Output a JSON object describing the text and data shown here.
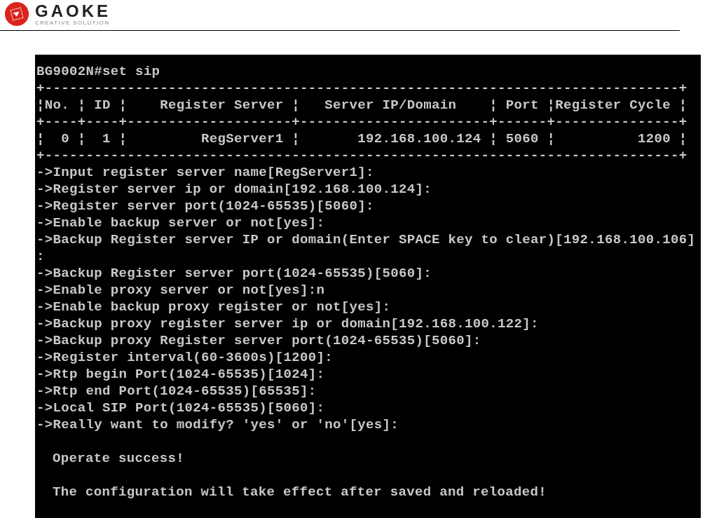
{
  "header": {
    "brand": "GAOKE",
    "tagline": "CREATIVE SOLUTION"
  },
  "terminal": {
    "lines": [
      "BG9002N#set sip",
      "+-----------------------------------------------------------------------------+",
      "¦No. ¦ ID ¦    Register Server ¦   Server IP/Domain    ¦ Port ¦Register Cycle ¦",
      "+----+----+--------------------+-----------------------+------+---------------+",
      "¦  0 ¦  1 ¦         RegServer1 ¦       192.168.100.124 ¦ 5060 ¦          1200 ¦",
      "+-----------------------------------------------------------------------------+",
      "->Input register server name[RegServer1]:",
      "->Register server ip or domain[192.168.100.124]:",
      "->Register server port(1024-65535)[5060]:",
      "->Enable backup server or not[yes]:",
      "->Backup Register server IP or domain(Enter SPACE key to clear)[192.168.100.106]",
      ":",
      "->Backup Register server port(1024-65535)[5060]:",
      "->Enable proxy server or not[yes]:n",
      "->Enable backup proxy register or not[yes]:",
      "->Backup proxy register server ip or domain[192.168.100.122]:",
      "->Backup proxy Register server port(1024-65535)[5060]:",
      "->Register interval(60-3600s)[1200]:",
      "->Rtp begin Port(1024-65535)[1024]:",
      "->Rtp end Port(1024-65535)[65535]:",
      "->Local SIP Port(1024-65535)[5060]:",
      "->Really want to modify? 'yes' or 'no'[yes]:"
    ],
    "messages": [
      "Operate success!",
      "The configuration will take effect after saved and reloaded!"
    ]
  }
}
